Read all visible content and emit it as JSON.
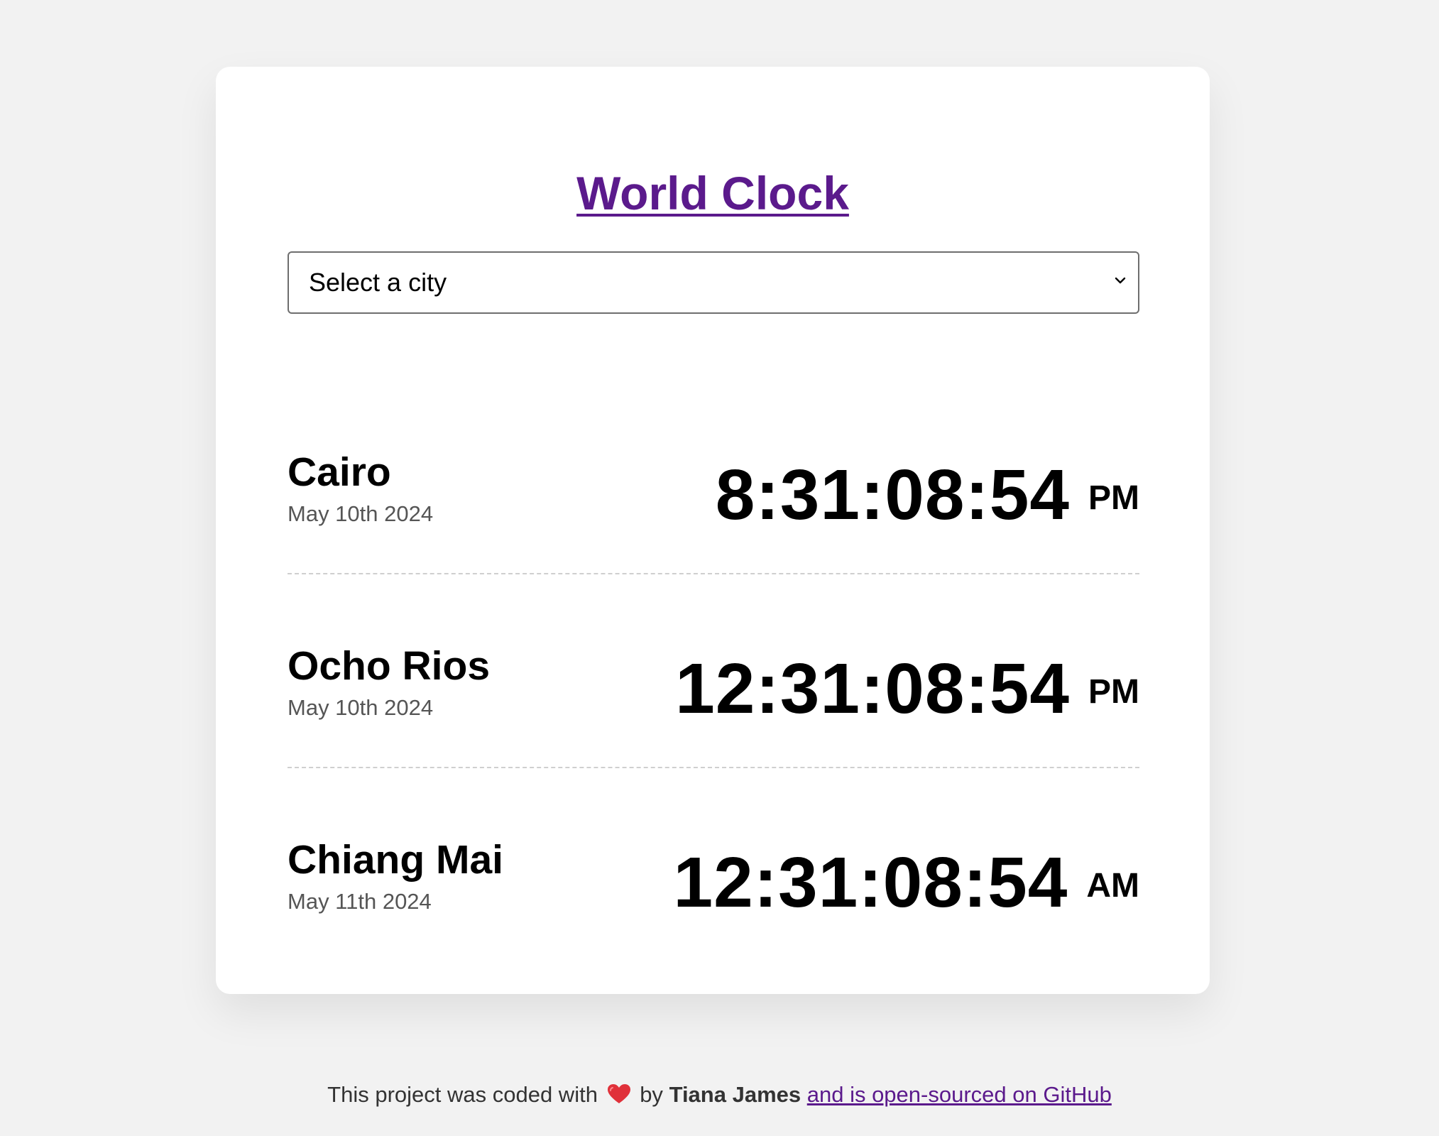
{
  "app": {
    "title": "World Clock"
  },
  "city_select": {
    "selected_label": "Select a city",
    "icon": "chevron-down-icon"
  },
  "cities": [
    {
      "name": "Cairo",
      "date": "May 10th 2024",
      "time": "8:31:08:54",
      "ampm": "PM"
    },
    {
      "name": "Ocho Rios",
      "date": "May 10th 2024",
      "time": "12:31:08:54",
      "ampm": "PM"
    },
    {
      "name": "Chiang Mai",
      "date": "May 11th 2024",
      "time": "12:31:08:54",
      "ampm": "AM"
    }
  ],
  "footer": {
    "prefix": "This project was coded with",
    "heart_icon": "heart-icon",
    "by": "by",
    "author": "Tiana James",
    "link_text": "and is open-sourced on GitHub"
  },
  "colors": {
    "background": "#f2f2f2",
    "card": "#ffffff",
    "link": "#5b1a8c",
    "heart": "#e0313a"
  }
}
